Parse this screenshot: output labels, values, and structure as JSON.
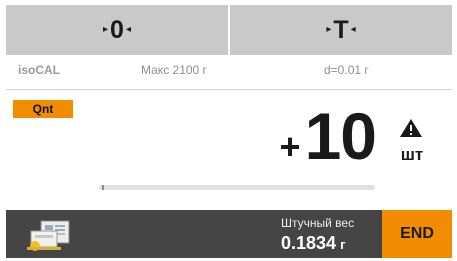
{
  "topbar": {
    "zero_key": {
      "symbol": "0",
      "left_arrow": "▸",
      "right_arrow": "◂"
    },
    "tare_key": {
      "symbol": "T",
      "left_arrow": "▸",
      "right_arrow": "◂"
    }
  },
  "info": {
    "mode": "isoCAL",
    "max_capacity": "Макс 2100 г",
    "readability": "d=0.01 г"
  },
  "badge": {
    "label": "Qnt"
  },
  "reading": {
    "sign": "+",
    "value": "10",
    "unit": "шт",
    "warning_icon": "warning-triangle-icon"
  },
  "bargraph": {
    "fill_fraction": 0.0
  },
  "bottom": {
    "app_icon": "counting-app-icon",
    "apw_label": "Штучный вес",
    "apw_value": "0.1834",
    "apw_unit": "г",
    "end_label": "END"
  },
  "colors": {
    "accent_orange": "#f28c00",
    "topbar_gray": "#c9c9c9",
    "bottombar_dark": "#454545"
  }
}
